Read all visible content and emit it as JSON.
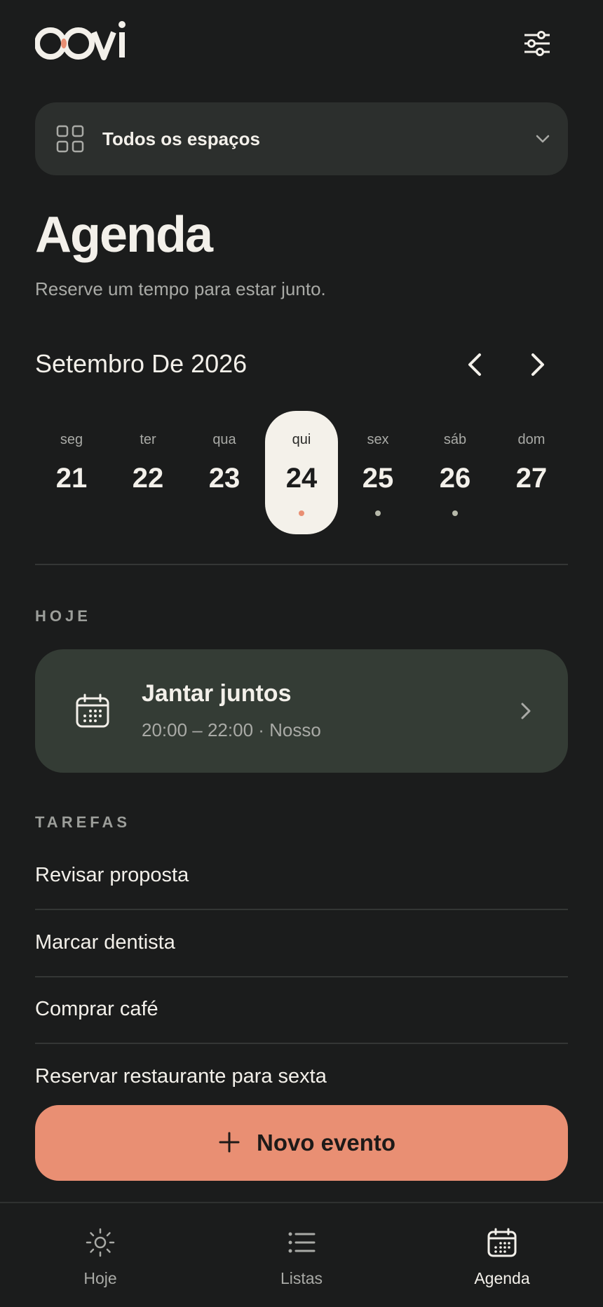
{
  "header": {
    "logo_alt": "Oovi",
    "filter_icon": "sliders-icon"
  },
  "space_selector": {
    "label": "Todos os espaços",
    "icon": "grid-icon"
  },
  "page": {
    "title": "Agenda",
    "subtitle": "Reserve um tempo para estar junto."
  },
  "calendar": {
    "month_label": "Setembro De 2026",
    "days": [
      {
        "name": "seg",
        "num": "21",
        "selected": false,
        "has_event": false
      },
      {
        "name": "ter",
        "num": "22",
        "selected": false,
        "has_event": false
      },
      {
        "name": "qua",
        "num": "23",
        "selected": false,
        "has_event": false
      },
      {
        "name": "qui",
        "num": "24",
        "selected": true,
        "has_event": true
      },
      {
        "name": "sex",
        "num": "25",
        "selected": false,
        "has_event": true
      },
      {
        "name": "sáb",
        "num": "26",
        "selected": false,
        "has_event": true
      },
      {
        "name": "dom",
        "num": "27",
        "selected": false,
        "has_event": false
      }
    ]
  },
  "today": {
    "label": "HOJE",
    "event": {
      "title": "Jantar juntos",
      "meta": "20:00 – 22:00 · Nosso"
    }
  },
  "tasks": {
    "label": "TAREFAS",
    "items": [
      "Revisar proposta",
      "Marcar dentista",
      "Comprar café",
      "Reservar restaurante para sexta"
    ]
  },
  "fab": {
    "label": "Novo evento"
  },
  "bottom_nav": {
    "items": [
      {
        "label": "Hoje",
        "icon": "sun-icon",
        "active": false
      },
      {
        "label": "Listas",
        "icon": "list-icon",
        "active": false
      },
      {
        "label": "Agenda",
        "icon": "calendar-icon",
        "active": true
      }
    ]
  },
  "colors": {
    "background": "#1b1c1c",
    "surface": "#2c2f2d",
    "event_card": "#343c35",
    "accent": "#e98f73",
    "selected_day": "#f4f1ea"
  }
}
